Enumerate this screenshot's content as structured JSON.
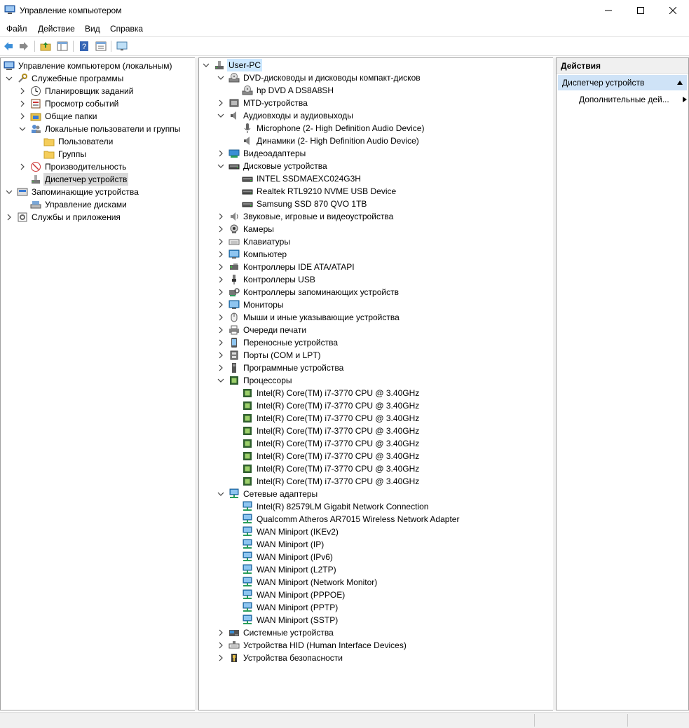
{
  "window": {
    "title": "Управление компьютером",
    "icon": "computer-management-icon",
    "controls": {
      "minimize": "—",
      "maximize": "☐",
      "close": "✕"
    }
  },
  "menu": [
    "Файл",
    "Действие",
    "Вид",
    "Справка"
  ],
  "toolbar": [
    "back-arrow-icon",
    "forward-arrow-icon",
    "up-folder-icon",
    "show-hide-tree-icon",
    "help-icon",
    "properties-icon",
    "monitor-icon"
  ],
  "left_tree": [
    {
      "label": "Управление компьютером (локальным)",
      "icon": "computer-management-icon",
      "expander": ""
    },
    {
      "label": "Служебные программы",
      "icon": "tools-icon",
      "expander": "v"
    },
    {
      "label": "Планировщик заданий",
      "icon": "clock-icon",
      "expander": ">"
    },
    {
      "label": "Просмотр событий",
      "icon": "event-viewer-icon",
      "expander": ">"
    },
    {
      "label": "Общие папки",
      "icon": "shared-folder-icon",
      "expander": ">"
    },
    {
      "label": "Локальные пользователи и группы",
      "icon": "users-icon",
      "expander": "v"
    },
    {
      "label": "Пользователи",
      "icon": "folder-icon",
      "expander": ""
    },
    {
      "label": "Группы",
      "icon": "folder-icon",
      "expander": ""
    },
    {
      "label": "Производительность",
      "icon": "performance-icon",
      "expander": ">"
    },
    {
      "label": "Диспетчер устройств",
      "icon": "device-manager-icon",
      "expander": "",
      "selected": true
    },
    {
      "label": "Запоминающие устройства",
      "icon": "storage-icon",
      "expander": "v"
    },
    {
      "label": "Управление дисками",
      "icon": "disk-management-icon",
      "expander": ""
    },
    {
      "label": "Службы и приложения",
      "icon": "services-icon",
      "expander": ">"
    }
  ],
  "device_tree": [
    {
      "label": "User-PC",
      "icon": "computer-icon",
      "expander": "v"
    },
    {
      "label": "DVD-дисководы и дисководы компакт-дисков",
      "icon": "dvd-icon",
      "expander": "v"
    },
    {
      "label": "hp DVD A  DS8A8SH",
      "icon": "dvd-icon",
      "expander": ""
    },
    {
      "label": "MTD-устройства",
      "icon": "mtd-icon",
      "expander": ">"
    },
    {
      "label": "Аудиовходы и аудиовыходы",
      "icon": "speaker-icon",
      "expander": "v"
    },
    {
      "label": "Microphone (2- High Definition Audio Device)",
      "icon": "microphone-icon",
      "expander": ""
    },
    {
      "label": "Динамики (2- High Definition Audio Device)",
      "icon": "speaker-icon",
      "expander": ""
    },
    {
      "label": "Видеоадаптеры",
      "icon": "display-adapter-icon",
      "expander": ">"
    },
    {
      "label": "Дисковые устройства",
      "icon": "disk-drive-icon",
      "expander": "v"
    },
    {
      "label": "INTEL SSDMAEXC024G3H",
      "icon": "disk-drive-icon",
      "expander": ""
    },
    {
      "label": "Realtek RTL9210 NVME USB Device",
      "icon": "disk-drive-icon",
      "expander": ""
    },
    {
      "label": "Samsung SSD 870 QVO 1TB",
      "icon": "disk-drive-icon",
      "expander": ""
    },
    {
      "label": "Звуковые, игровые и видеоустройства",
      "icon": "sound-icon",
      "expander": ">"
    },
    {
      "label": "Камеры",
      "icon": "camera-icon",
      "expander": ">"
    },
    {
      "label": "Клавиатуры",
      "icon": "keyboard-icon",
      "expander": ">"
    },
    {
      "label": "Компьютер",
      "icon": "monitor-icon",
      "expander": ">"
    },
    {
      "label": "Контроллеры IDE ATA/ATAPI",
      "icon": "ide-controller-icon",
      "expander": ">"
    },
    {
      "label": "Контроллеры USB",
      "icon": "usb-icon",
      "expander": ">"
    },
    {
      "label": "Контроллеры запоминающих устройств",
      "icon": "storage-controller-icon",
      "expander": ">"
    },
    {
      "label": "Мониторы",
      "icon": "monitor-icon",
      "expander": ">"
    },
    {
      "label": "Мыши и иные указывающие устройства",
      "icon": "mouse-icon",
      "expander": ">"
    },
    {
      "label": "Очереди печати",
      "icon": "printer-icon",
      "expander": ">"
    },
    {
      "label": "Переносные устройства",
      "icon": "portable-device-icon",
      "expander": ">"
    },
    {
      "label": "Порты (COM и LPT)",
      "icon": "port-icon",
      "expander": ">"
    },
    {
      "label": "Программные устройства",
      "icon": "software-device-icon",
      "expander": ">"
    },
    {
      "label": "Процессоры",
      "icon": "cpu-icon",
      "expander": "v"
    },
    {
      "label": "Intel(R) Core(TM) i7-3770 CPU @ 3.40GHz",
      "icon": "cpu-icon",
      "expander": ""
    },
    {
      "label": "Intel(R) Core(TM) i7-3770 CPU @ 3.40GHz",
      "icon": "cpu-icon",
      "expander": ""
    },
    {
      "label": "Intel(R) Core(TM) i7-3770 CPU @ 3.40GHz",
      "icon": "cpu-icon",
      "expander": ""
    },
    {
      "label": "Intel(R) Core(TM) i7-3770 CPU @ 3.40GHz",
      "icon": "cpu-icon",
      "expander": ""
    },
    {
      "label": "Intel(R) Core(TM) i7-3770 CPU @ 3.40GHz",
      "icon": "cpu-icon",
      "expander": ""
    },
    {
      "label": "Intel(R) Core(TM) i7-3770 CPU @ 3.40GHz",
      "icon": "cpu-icon",
      "expander": ""
    },
    {
      "label": "Intel(R) Core(TM) i7-3770 CPU @ 3.40GHz",
      "icon": "cpu-icon",
      "expander": ""
    },
    {
      "label": "Intel(R) Core(TM) i7-3770 CPU @ 3.40GHz",
      "icon": "cpu-icon",
      "expander": ""
    },
    {
      "label": "Сетевые адаптеры",
      "icon": "network-adapter-icon",
      "expander": "v"
    },
    {
      "label": "Intel(R) 82579LM Gigabit Network Connection",
      "icon": "network-adapter-icon",
      "expander": ""
    },
    {
      "label": "Qualcomm Atheros AR7015 Wireless Network Adapter",
      "icon": "network-adapter-icon",
      "expander": ""
    },
    {
      "label": "WAN Miniport (IKEv2)",
      "icon": "network-adapter-icon",
      "expander": ""
    },
    {
      "label": "WAN Miniport (IP)",
      "icon": "network-adapter-icon",
      "expander": ""
    },
    {
      "label": "WAN Miniport (IPv6)",
      "icon": "network-adapter-icon",
      "expander": ""
    },
    {
      "label": "WAN Miniport (L2TP)",
      "icon": "network-adapter-icon",
      "expander": ""
    },
    {
      "label": "WAN Miniport (Network Monitor)",
      "icon": "network-adapter-icon",
      "expander": ""
    },
    {
      "label": "WAN Miniport (PPPOE)",
      "icon": "network-adapter-icon",
      "expander": ""
    },
    {
      "label": "WAN Miniport (PPTP)",
      "icon": "network-adapter-icon",
      "expander": ""
    },
    {
      "label": "WAN Miniport (SSTP)",
      "icon": "network-adapter-icon",
      "expander": ""
    },
    {
      "label": "Системные устройства",
      "icon": "system-device-icon",
      "expander": ">"
    },
    {
      "label": "Устройства HID (Human Interface Devices)",
      "icon": "hid-icon",
      "expander": ">"
    },
    {
      "label": "Устройства безопасности",
      "icon": "security-device-icon",
      "expander": ">"
    }
  ],
  "actions": {
    "header": "Действия",
    "section": "Диспетчер устройств",
    "item": "Дополнительные дей..."
  },
  "colors": {
    "selection_blue": "#cfe3f7",
    "selection_gray": "#d9d9d9",
    "pane_border": "#a0a0a0"
  }
}
